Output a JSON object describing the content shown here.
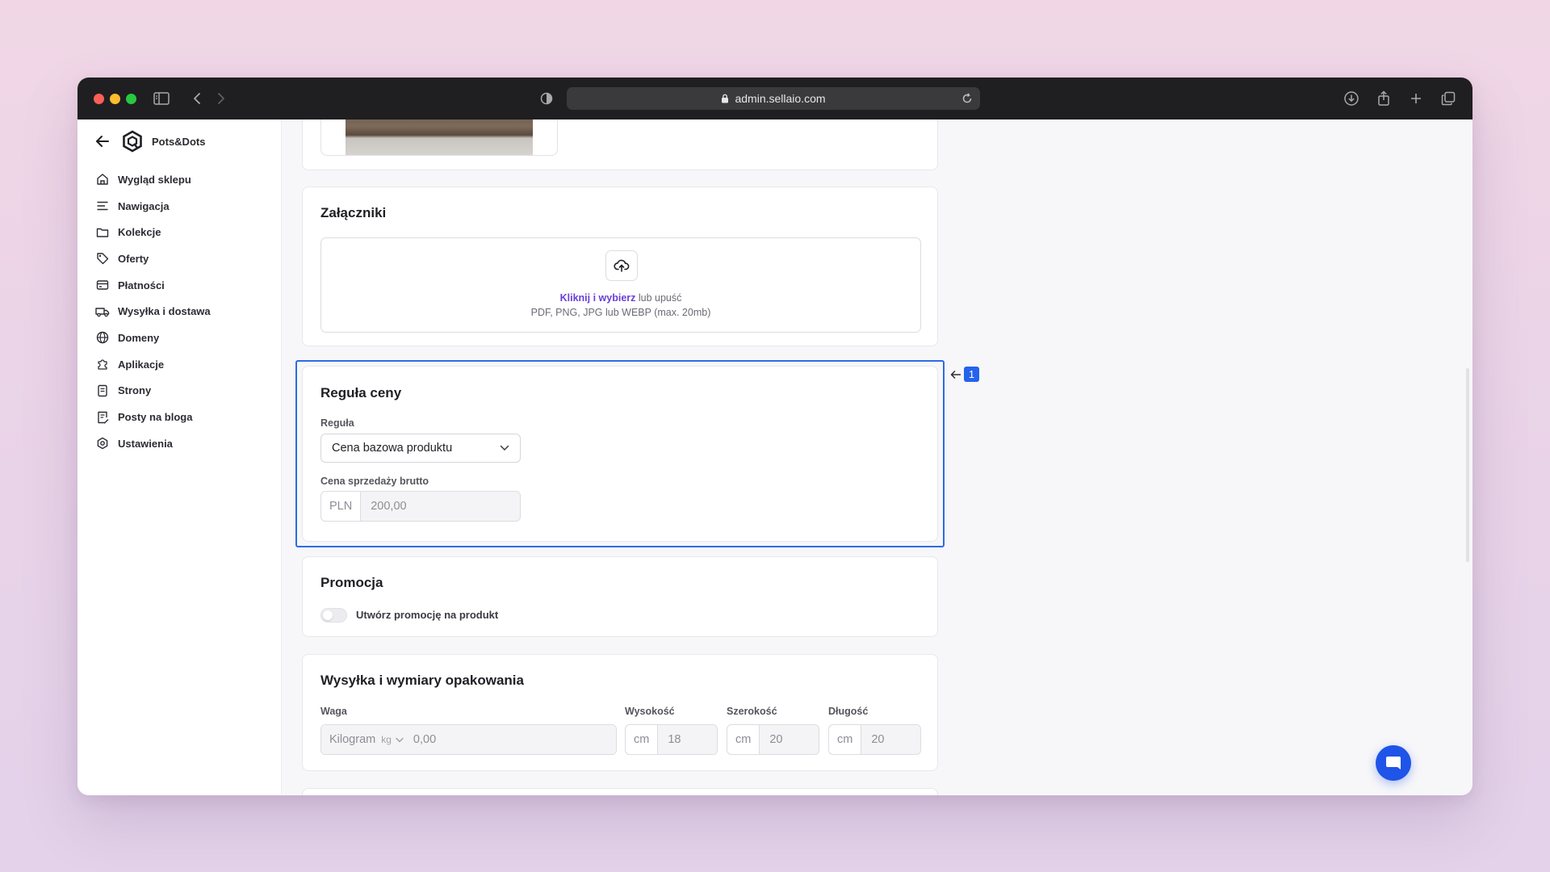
{
  "browser": {
    "url": "admin.sellaio.com"
  },
  "brand": {
    "name": "Pots&Dots"
  },
  "sidebar": {
    "items": [
      {
        "label": "Wygląd sklepu",
        "icon": "home-icon"
      },
      {
        "label": "Nawigacja",
        "icon": "menu-lines-icon"
      },
      {
        "label": "Kolekcje",
        "icon": "folder-icon"
      },
      {
        "label": "Oferty",
        "icon": "tag-icon"
      },
      {
        "label": "Płatności",
        "icon": "credit-card-icon"
      },
      {
        "label": "Wysyłka i dostawa",
        "icon": "truck-icon"
      },
      {
        "label": "Domeny",
        "icon": "globe-icon"
      },
      {
        "label": "Aplikacje",
        "icon": "puzzle-icon"
      },
      {
        "label": "Strony",
        "icon": "page-icon"
      },
      {
        "label": "Posty na bloga",
        "icon": "blog-post-icon"
      },
      {
        "label": "Ustawienia",
        "icon": "gear-icon"
      }
    ]
  },
  "attachments": {
    "title": "Załączniki",
    "link_text": "Kliknij i wybierz",
    "after_link": " lub upuść",
    "formats": "PDF, PNG, JPG lub WEBP (max. 20mb)"
  },
  "price_rule": {
    "badge": "1",
    "title": "Reguła ceny",
    "rule_label": "Reguła",
    "rule_value": "Cena bazowa produktu",
    "price_label": "Cena sprzedaży brutto",
    "currency": "PLN",
    "price": "200,00"
  },
  "promotion": {
    "title": "Promocja",
    "toggle_label": "Utwórz promocję na produkt",
    "enabled": false
  },
  "shipping": {
    "title": "Wysyłka i wymiary opakowania",
    "weight_label": "Waga",
    "weight_unit_name": "Kilogram",
    "weight_unit": "kg",
    "weight_value": "0,00",
    "height_label": "Wysokość",
    "height_unit": "cm",
    "height_value": "18",
    "width_label": "Szerokość",
    "width_unit": "cm",
    "width_value": "20",
    "length_label": "Długość",
    "length_unit": "cm",
    "length_value": "20"
  },
  "colors": {
    "accent": "#2f6be4",
    "link": "#6a3fd6",
    "chat_button": "#1f54e8"
  }
}
